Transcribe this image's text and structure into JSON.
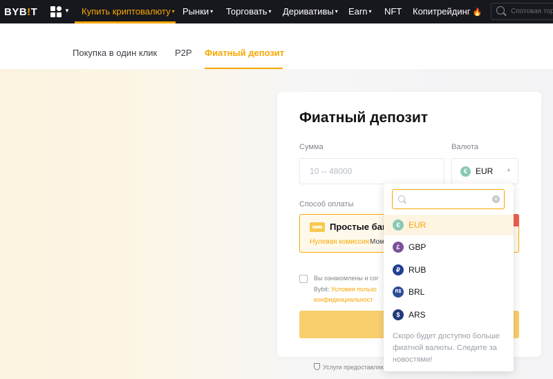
{
  "nav": {
    "logo_a": "BYB",
    "logo_bang": "!",
    "logo_b": "T",
    "items": [
      {
        "label": "Купить криптовалюту",
        "caret": "▾"
      },
      {
        "label": "Рынки",
        "caret": "▾"
      },
      {
        "label": "Торговать",
        "caret": "▾"
      },
      {
        "label": "Деривативы",
        "caret": "▾"
      },
      {
        "label": "Earn",
        "caret": "▾"
      },
      {
        "label": "NFT"
      },
      {
        "label": "Копитрейдинг"
      }
    ],
    "search_placeholder": "Спотовая торговля"
  },
  "subtabs": [
    {
      "label": "Покупка в один клик"
    },
    {
      "label": "P2P"
    },
    {
      "label": "Фиатный депозит"
    }
  ],
  "card": {
    "title": "Фиатный депозит",
    "amount_label": "Сумма",
    "amount_placeholder": "10 -- 48000",
    "currency_label": "Валюта",
    "currency_symbol": "€",
    "currency_value": "EUR",
    "method_label": "Способ оплаты",
    "method_title": "Простые бан",
    "method_sub1": "Нулевая комиссия",
    "method_sub2": "Мом",
    "agree_1": "Вы ознакомлены и сог",
    "agree_2a": "Bybit: ",
    "agree_2b": "Условия пользо",
    "agree_3": "конфиденциальност"
  },
  "footnote": "Услуги предоставляю",
  "dropdown": {
    "items": [
      {
        "code": "EUR",
        "symbol": "€",
        "color": "#8bc8b6"
      },
      {
        "code": "GBP",
        "symbol": "£",
        "color": "#7d4f9b"
      },
      {
        "code": "RUB",
        "symbol": "₽",
        "color": "#1f3f8f"
      },
      {
        "code": "BRL",
        "symbol": "R$",
        "color": "#2c4a97"
      },
      {
        "code": "ARS",
        "symbol": "$",
        "color": "#233a7c"
      }
    ],
    "note": "Скоро будет доступно больше фиатной валюты. Следите за новостями!"
  },
  "colors": {
    "accent": "#f7a600",
    "nav_bg": "#17181e"
  }
}
